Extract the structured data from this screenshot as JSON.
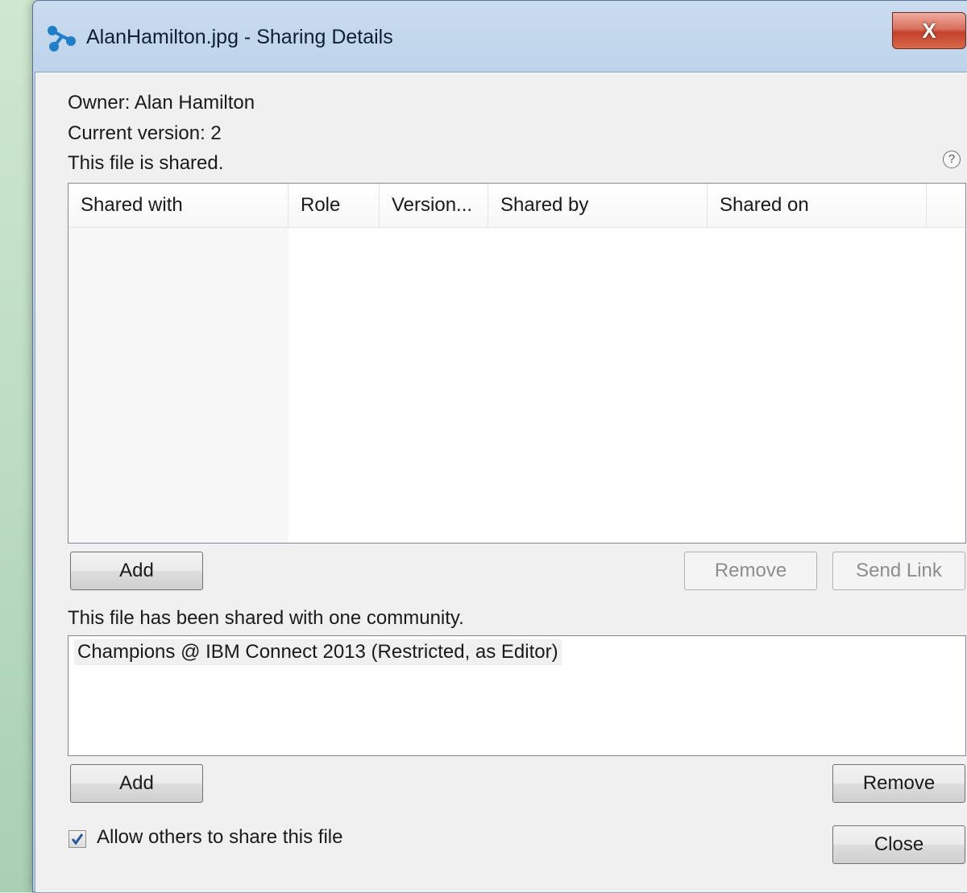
{
  "window": {
    "title": "AlanHamilton.jpg - Sharing Details",
    "close_label": "X"
  },
  "file_info": {
    "owner": "Owner: Alan Hamilton",
    "version": "Current version: 2",
    "shared_status": "This file is shared."
  },
  "help": {
    "label": "?"
  },
  "shares_table": {
    "columns": [
      "Shared with",
      "Role",
      "Version...",
      "Shared by",
      "Shared on"
    ],
    "rows": []
  },
  "shares_actions": {
    "add_label": "Add",
    "remove_label": "Remove",
    "send_link_label": "Send Link"
  },
  "community": {
    "heading": "This file has been shared with one community.",
    "items": [
      "Champions @ IBM Connect 2013 (Restricted, as Editor)"
    ],
    "add_label": "Add",
    "remove_label": "Remove"
  },
  "options": {
    "allow_share_label": "Allow others to share this file",
    "allow_share_checked": true
  },
  "footer": {
    "close_label": "Close"
  },
  "colors": {
    "title_bar": "#bed3ea",
    "close_button": "#c5412b",
    "icon_accent": "#1f7fc8"
  }
}
